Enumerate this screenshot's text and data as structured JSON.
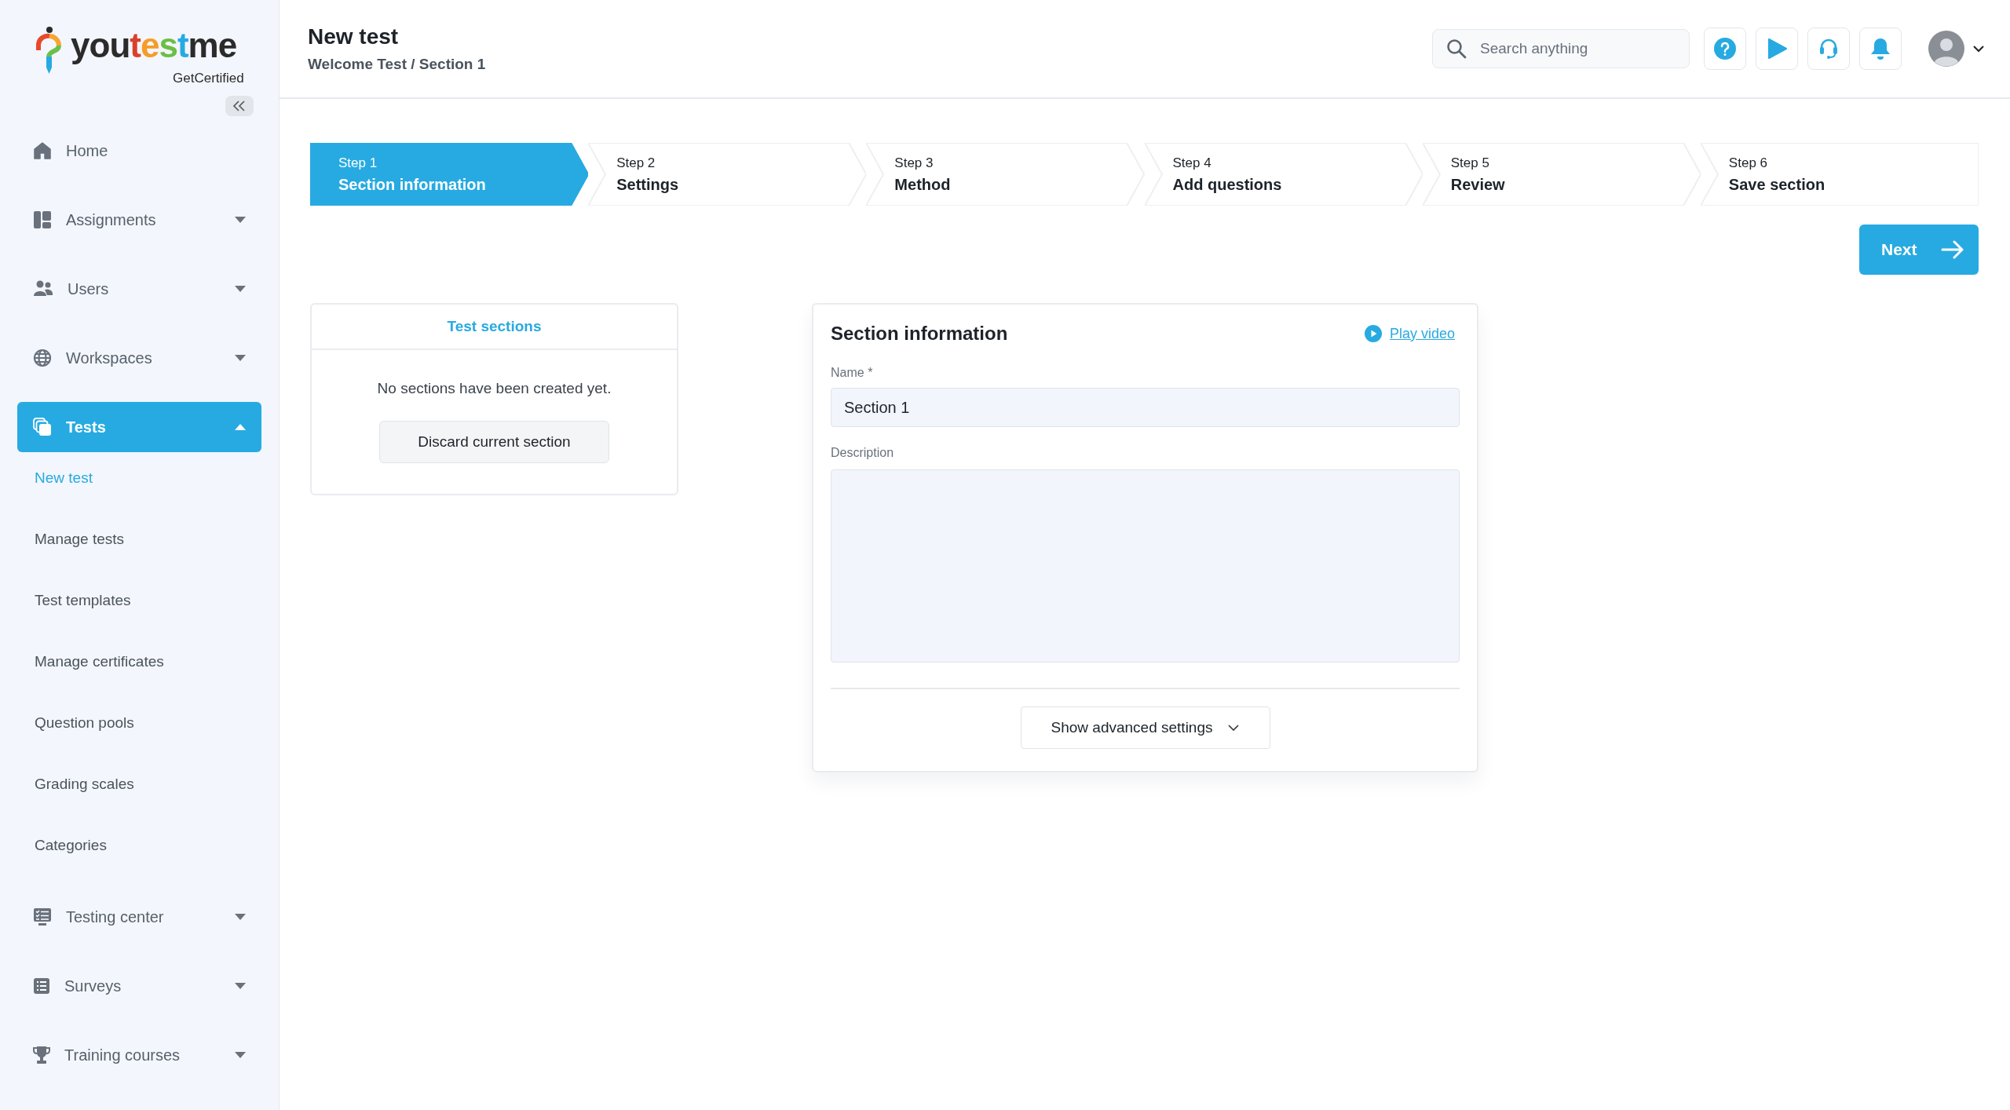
{
  "logo": {
    "wordmark": "youtestme",
    "tagline": "GetCertified"
  },
  "sidebar": {
    "items": [
      {
        "kind": "link",
        "label": "Home",
        "selected": false
      },
      {
        "kind": "group",
        "label": "Assignments",
        "selected": false,
        "expanded": false
      },
      {
        "kind": "group",
        "label": "Users",
        "selected": false,
        "expanded": false
      },
      {
        "kind": "group",
        "label": "Workspaces",
        "selected": false,
        "expanded": false
      },
      {
        "kind": "group",
        "label": "Tests",
        "selected": true,
        "expanded": true,
        "children": [
          {
            "label": "New test",
            "selected": true
          },
          {
            "label": "Manage tests",
            "selected": false
          },
          {
            "label": "Test templates",
            "selected": false
          },
          {
            "label": "Manage certificates",
            "selected": false
          },
          {
            "label": "Question pools",
            "selected": false
          },
          {
            "label": "Grading scales",
            "selected": false
          },
          {
            "label": "Categories",
            "selected": false
          }
        ]
      },
      {
        "kind": "group",
        "label": "Testing center",
        "selected": false,
        "expanded": false
      },
      {
        "kind": "group",
        "label": "Surveys",
        "selected": false,
        "expanded": false
      },
      {
        "kind": "group",
        "label": "Training courses",
        "selected": false,
        "expanded": false
      }
    ]
  },
  "header": {
    "title": "New test",
    "breadcrumb": "Welcome Test / Section 1",
    "search": {
      "placeholder": "Search anything"
    }
  },
  "steps": [
    {
      "step": "Step 1",
      "title": "Section information",
      "selected": true
    },
    {
      "step": "Step 2",
      "title": "Settings",
      "selected": false
    },
    {
      "step": "Step 3",
      "title": "Method",
      "selected": false
    },
    {
      "step": "Step 4",
      "title": "Add questions",
      "selected": false
    },
    {
      "step": "Step 5",
      "title": "Review",
      "selected": false
    },
    {
      "step": "Step 6",
      "title": "Save section",
      "selected": false
    }
  ],
  "next_button": "Next",
  "test_sections": {
    "title": "Test sections",
    "empty_text": "No sections have been created yet.",
    "discard_button": "Discard current section"
  },
  "section_form": {
    "title": "Section information",
    "video_link": "Play video",
    "name_label": "Name *",
    "name_value": "Section 1",
    "description_label": "Description",
    "advanced_button": "Show advanced settings"
  }
}
